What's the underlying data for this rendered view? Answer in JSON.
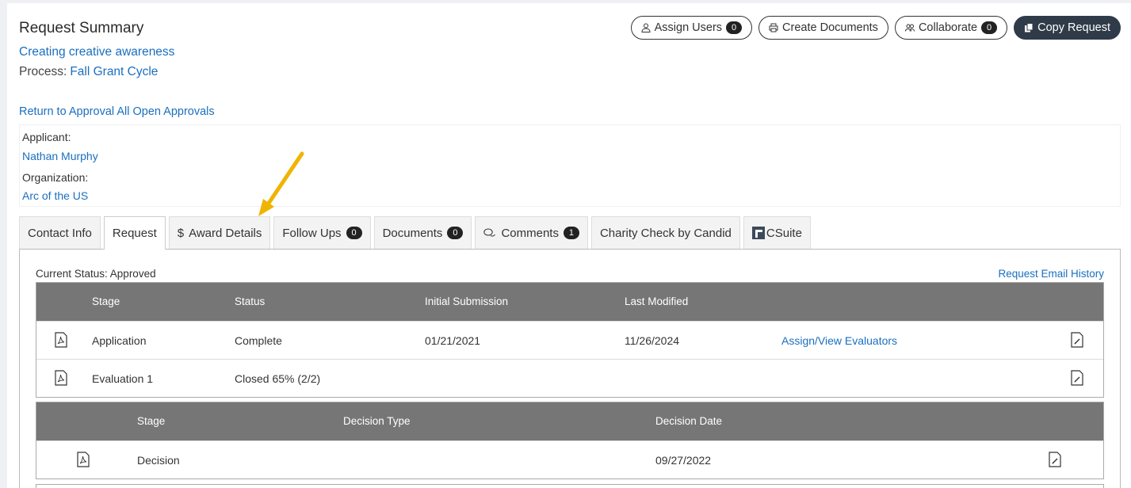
{
  "header": {
    "title": "Request Summary",
    "subtitle": "Creating creative awareness",
    "process_label": "Process:",
    "process_value": "Fall Grant Cycle",
    "return_link": "Return to Approval All Open Approvals"
  },
  "actions": {
    "assign_users": "Assign Users",
    "assign_users_count": "0",
    "create_documents": "Create Documents",
    "collaborate": "Collaborate",
    "collaborate_count": "0",
    "copy_request": "Copy Request"
  },
  "applicant": {
    "applicant_label": "Applicant:",
    "applicant_value": "Nathan Murphy",
    "organization_label": "Organization:",
    "organization_value": "Arc of the US"
  },
  "tabs": [
    {
      "label": "Contact Info"
    },
    {
      "label": "Request",
      "active": true
    },
    {
      "label": "Award Details",
      "icon": "dollar-icon"
    },
    {
      "label": "Follow Ups",
      "count": "0"
    },
    {
      "label": "Documents",
      "count": "0"
    },
    {
      "label": "Comments",
      "count": "1",
      "icon": "comments-icon"
    },
    {
      "label": "Charity Check by Candid"
    },
    {
      "label": "CSuite",
      "icon": "csuite-logo-icon"
    }
  ],
  "panel": {
    "current_status": "Current Status: Approved",
    "email_history": "Request Email History"
  },
  "stages_table": {
    "headers": [
      "Stage",
      "Status",
      "Initial Submission",
      "Last Modified"
    ],
    "rows": [
      {
        "stage": "Application",
        "status": "Complete",
        "initial": "01/21/2021",
        "modified": "11/26/2024",
        "action": "Assign/View Evaluators"
      },
      {
        "stage": "Evaluation 1",
        "status": "Closed 65% (2/2)",
        "initial": "",
        "modified": "",
        "action": ""
      }
    ]
  },
  "decision_table": {
    "headers": [
      "Stage",
      "Decision Type",
      "Decision Date"
    ],
    "rows": [
      {
        "stage": "Decision",
        "type": "",
        "date": "09/27/2022"
      }
    ]
  },
  "colors": {
    "link": "#1a6fbf",
    "table_header": "#767676",
    "dark_button": "#2f3b48",
    "arrow": "#f0b400"
  }
}
